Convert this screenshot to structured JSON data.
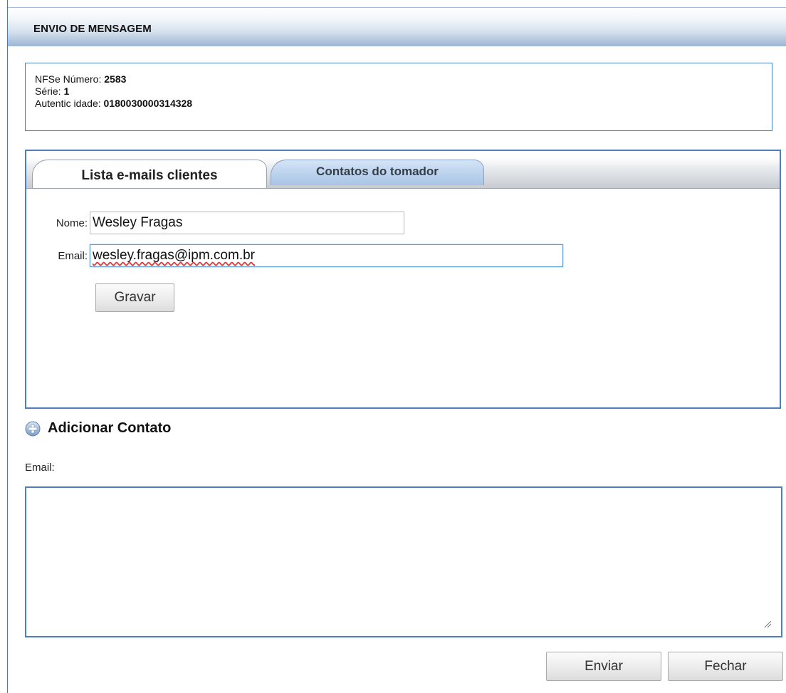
{
  "header": {
    "title": "ENVIO DE MENSAGEM"
  },
  "info": {
    "numero_label": "NFSe Número: ",
    "numero_value": "2583",
    "serie_label": "Série: ",
    "serie_value": "1",
    "autenticidade_label": "Autentic idade: ",
    "autenticidade_value": "0180030000314328"
  },
  "tabs": [
    {
      "label": "Lista e-mails clientes",
      "active": true
    },
    {
      "label": "Contatos do tomador",
      "active": false
    }
  ],
  "form": {
    "nome_label": "Nome:",
    "nome_value": "Wesley Fragas",
    "email_label": "Email:",
    "email_value": "wesley.fragas@ipm.com.br",
    "gravar_label": "Gravar"
  },
  "add_contact": {
    "label": "Adicionar Contato",
    "icon": "plus-circle-icon"
  },
  "message": {
    "email_label": "Email:",
    "email_textarea_value": ""
  },
  "footer": {
    "enviar_label": "Enviar",
    "fechar_label": "Fechar"
  },
  "colors": {
    "border_blue": "#4f7dc0",
    "header_gradient_end": "#9cb6d4",
    "inactive_tab": "#a8c4e6",
    "focus_ring": "#5d9bd8",
    "spellcheck_underline": "#e33b3b"
  }
}
